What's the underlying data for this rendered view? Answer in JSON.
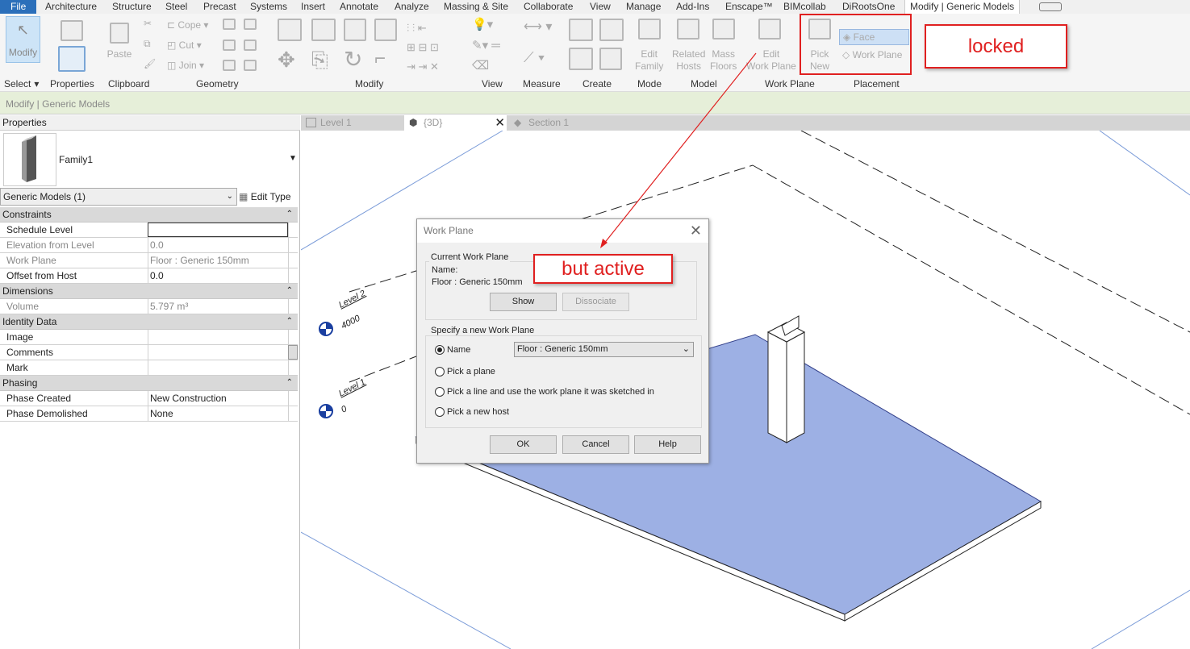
{
  "menu": {
    "items": [
      "File",
      "Architecture",
      "Structure",
      "Steel",
      "Precast",
      "Systems",
      "Insert",
      "Annotate",
      "Analyze",
      "Massing & Site",
      "Collaborate",
      "View",
      "Manage",
      "Add-Ins",
      "Enscape™",
      "BIMcollab",
      "DiRootsOne",
      "Modify | Generic Models"
    ]
  },
  "ribbon": {
    "modify_btn": "Modify",
    "select_label": "Select",
    "properties_label": "Properties",
    "clipboard": {
      "paste": "Paste",
      "label": "Clipboard"
    },
    "geometry": {
      "cope": "Cope",
      "cut": "Cut",
      "join": "Join",
      "label": "Geometry"
    },
    "modify_label": "Modify",
    "view_label": "View",
    "measure_label": "Measure",
    "create_label": "Create",
    "mode": {
      "edit_family_1": "Edit",
      "edit_family_2": "Family",
      "label": "Mode"
    },
    "model": {
      "related_1": "Related",
      "related_2": "Hosts",
      "mass_1": "Mass",
      "mass_2": "Floors",
      "label": "Model"
    },
    "workplane": {
      "edit_1": "Edit",
      "edit_2": "Work Plane",
      "label": "Work Plane"
    },
    "placement": {
      "pick_1": "Pick",
      "pick_2": "New",
      "face": "Face",
      "work_plane": "Work Plane",
      "label": "Placement"
    }
  },
  "context_bar": "Modify | Generic Models",
  "properties": {
    "title": "Properties",
    "family": "Family1",
    "type_selector": "Generic Models (1)",
    "edit_type": "Edit Type",
    "groups": [
      {
        "name": "Constraints",
        "rows": [
          {
            "k": "Schedule Level",
            "v": ""
          },
          {
            "k": "Elevation from Level",
            "v": "0.0"
          },
          {
            "k": "Work Plane",
            "v": "Floor : Generic 150mm"
          },
          {
            "k": "Offset from Host",
            "v": "0.0"
          }
        ]
      },
      {
        "name": "Dimensions",
        "rows": [
          {
            "k": "Volume",
            "v": "5.797 m³"
          }
        ]
      },
      {
        "name": "Identity Data",
        "rows": [
          {
            "k": "Image",
            "v": ""
          },
          {
            "k": "Comments",
            "v": ""
          },
          {
            "k": "Mark",
            "v": ""
          }
        ]
      },
      {
        "name": "Phasing",
        "rows": [
          {
            "k": "Phase Created",
            "v": "New Construction"
          },
          {
            "k": "Phase Demolished",
            "v": "None"
          }
        ]
      }
    ]
  },
  "view_tabs": [
    "Level 1",
    "{3D}",
    "Section 1"
  ],
  "levels": [
    {
      "name": "Level 2",
      "elev": "4000"
    },
    {
      "name": "Level 1",
      "elev": "0"
    }
  ],
  "dialog": {
    "title": "Work Plane",
    "current_group": "Current Work Plane",
    "name_label": "Name:",
    "current_value": "Floor : Generic 150mm",
    "show": "Show",
    "dissociate": "Dissociate",
    "specify_group": "Specify a new Work Plane",
    "opt_name": "Name",
    "name_select": "Floor : Generic 150mm",
    "opt_pick_plane": "Pick a plane",
    "opt_pick_line": "Pick a line and use the work plane it was sketched in",
    "opt_pick_host": "Pick a new host",
    "ok": "OK",
    "cancel": "Cancel",
    "help": "Help"
  },
  "annotations": {
    "locked": "locked",
    "but_active": "but active"
  },
  "colors": {
    "file_tab": "#2b6fba",
    "context_bar": "#e6efd9",
    "floor": "#9db0e4",
    "callout": "#e02020"
  }
}
